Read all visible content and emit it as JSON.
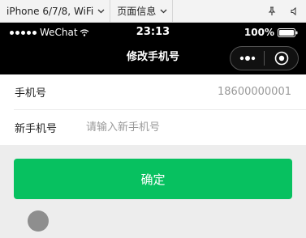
{
  "devtools": {
    "device_label": "iPhone 6/7/8, WiFi",
    "page_info_label": "页面信息"
  },
  "statusbar": {
    "carrier": "WeChat",
    "time": "23:13",
    "battery": "100%"
  },
  "navbar": {
    "title": "修改手机号"
  },
  "form": {
    "phone_label": "手机号",
    "phone_value": "18600000001",
    "new_phone_label": "新手机号",
    "new_phone_placeholder": "请输入新手机号",
    "new_phone_value": ""
  },
  "actions": {
    "confirm_label": "确定"
  }
}
